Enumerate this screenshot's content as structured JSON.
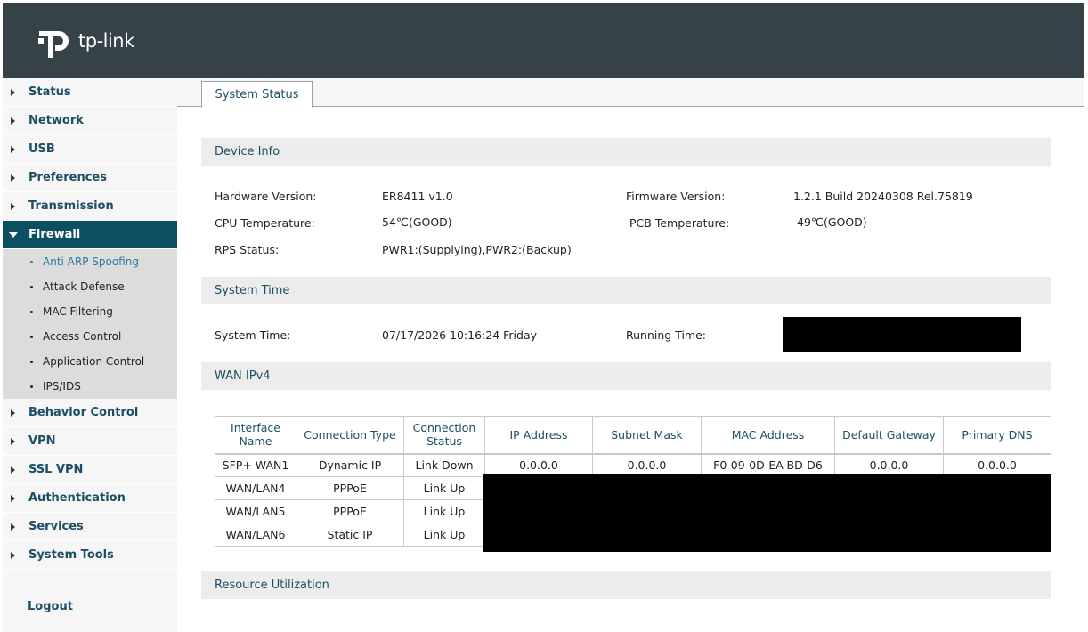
{
  "brand": {
    "logo_text": "tp-link"
  },
  "sidebar": {
    "items_top": [
      {
        "label": "Status"
      },
      {
        "label": "Network"
      },
      {
        "label": "USB"
      },
      {
        "label": "Preferences"
      },
      {
        "label": "Transmission"
      },
      {
        "label": "Firewall"
      }
    ],
    "firewall_sub": [
      {
        "label": "Anti ARP Spoofing"
      },
      {
        "label": "Attack Defense"
      },
      {
        "label": "MAC Filtering"
      },
      {
        "label": "Access Control"
      },
      {
        "label": "Application Control"
      },
      {
        "label": "IPS/IDS"
      }
    ],
    "items_bottom": [
      {
        "label": "Behavior Control"
      },
      {
        "label": "VPN"
      },
      {
        "label": "SSL VPN"
      },
      {
        "label": "Authentication"
      },
      {
        "label": "Services"
      },
      {
        "label": "System Tools"
      }
    ],
    "logout": "Logout"
  },
  "tabs": [
    {
      "label": "System Status"
    }
  ],
  "device_info": {
    "title": "Device Info",
    "hardware_version_label": "Hardware Version:",
    "hardware_version": "ER8411 v1.0",
    "firmware_version_label": "Firmware Version:",
    "firmware_version": "1.2.1 Build 20240308 Rel.75819",
    "cpu_temp_label": "CPU Temperature:",
    "cpu_temp": "54℃(GOOD)",
    "pcb_temp_label": "PCB Temperature:",
    "pcb_temp": "49℃(GOOD)",
    "rps_status_label": "RPS Status:",
    "rps_status": "PWR1:(Supplying),PWR2:(Backup)"
  },
  "system_time": {
    "title": "System Time",
    "system_time_label": "System Time:",
    "system_time": "07/17/2026 10:16:24 Friday",
    "running_time_label": "Running Time:"
  },
  "wan_ipv4": {
    "title": "WAN IPv4",
    "columns": [
      "Interface Name",
      "Connection Type",
      "Connection Status",
      "IP Address",
      "Subnet Mask",
      "MAC Address",
      "Default Gateway",
      "Primary DNS"
    ],
    "rows": [
      [
        "SFP+ WAN1",
        "Dynamic IP",
        "Link Down",
        "0.0.0.0",
        "0.0.0.0",
        "F0-09-0D-EA-BD-D6",
        "0.0.0.0",
        "0.0.0.0"
      ],
      [
        "WAN/LAN4",
        "PPPoE",
        "Link Up",
        "",
        "",
        "",
        "",
        ""
      ],
      [
        "WAN/LAN5",
        "PPPoE",
        "Link Up",
        "",
        "",
        "",
        "",
        ""
      ],
      [
        "WAN/LAN6",
        "Static IP",
        "Link Up",
        "",
        "",
        "",
        "",
        ""
      ]
    ]
  },
  "resource_utilization": {
    "title": "Resource Utilization"
  },
  "colors": {
    "header_bg": "#354349",
    "active_nav_bg": "#0c4f63",
    "accent_text": "#1d4e63",
    "redaction": "#000000"
  },
  "icons": {
    "logo": "tp-link-logo-icon",
    "collapsed": "caret-right-icon",
    "expanded": "caret-down-icon"
  }
}
